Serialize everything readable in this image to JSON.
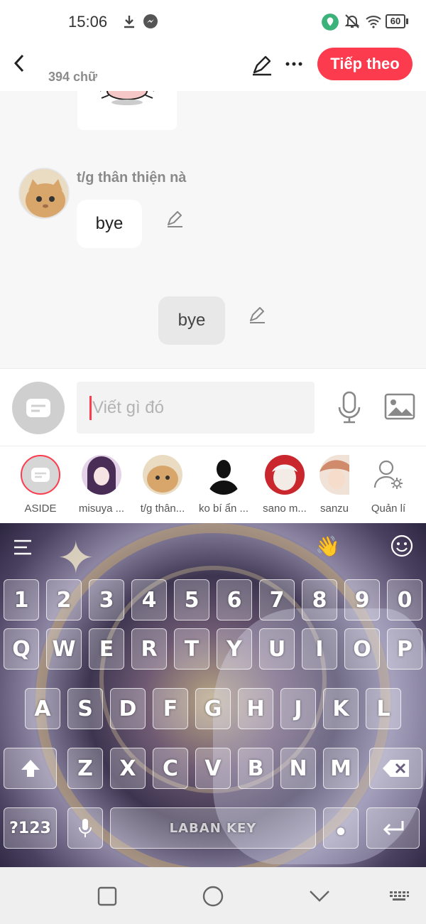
{
  "status_bar": {
    "time": "15:06",
    "battery": "60",
    "icons": [
      "download-icon",
      "messenger-icon",
      "shield-icon",
      "bell-off-icon",
      "wifi-icon",
      "battery-icon"
    ]
  },
  "header": {
    "word_count": "394 chữ",
    "next_label": "Tiếp theo",
    "accent_color": "#fc3c4e"
  },
  "chat": {
    "sender_name": "t/g thân thiện nà",
    "messages": [
      {
        "text": "bye",
        "side": "left"
      },
      {
        "text": "bye",
        "side": "center"
      }
    ]
  },
  "input": {
    "placeholder": "Viết gì đó"
  },
  "characters": [
    {
      "label": "ASIDE"
    },
    {
      "label": "misuya ..."
    },
    {
      "label": "t/g thân..."
    },
    {
      "label": "ko bí ẩn ..."
    },
    {
      "label": "sano m..."
    },
    {
      "label": "sanzu"
    },
    {
      "label": "Quản lí"
    }
  ],
  "keyboard": {
    "row_numbers": [
      "1",
      "2",
      "3",
      "4",
      "5",
      "6",
      "7",
      "8",
      "9",
      "0"
    ],
    "row_1": [
      "Q",
      "W",
      "E",
      "R",
      "T",
      "Y",
      "U",
      "I",
      "O",
      "P"
    ],
    "row_2": [
      "A",
      "S",
      "D",
      "F",
      "G",
      "H",
      "J",
      "K",
      "L"
    ],
    "row_3": [
      "Z",
      "X",
      "C",
      "V",
      "B",
      "N",
      "M"
    ],
    "symbols_label": "?123",
    "space_label": "LABAN KEY",
    "wave_emoji": "👋"
  }
}
